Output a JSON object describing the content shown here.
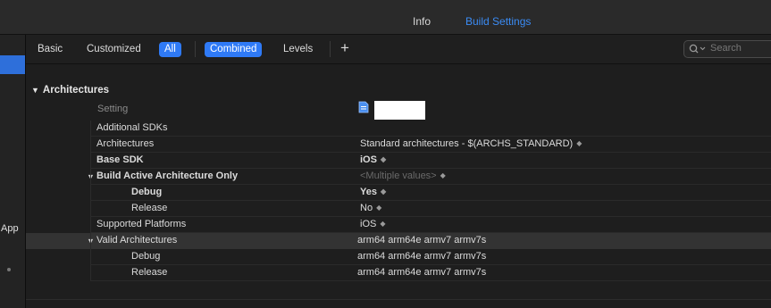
{
  "top_tabs": [
    {
      "label": "Info",
      "active": false
    },
    {
      "label": "Build Settings",
      "active": true
    }
  ],
  "sidebar": {
    "app_label": "App"
  },
  "filters": {
    "basic": "Basic",
    "customized": "Customized",
    "all": "All",
    "combined": "Combined",
    "levels": "Levels",
    "add": "+"
  },
  "search": {
    "placeholder": "Search"
  },
  "section": {
    "title": "Architectures"
  },
  "header_row": {
    "name": "Setting"
  },
  "rows": [
    {
      "name": "Additional SDKs",
      "value": ""
    },
    {
      "name": "Architectures",
      "value": "Standard architectures  -  $(ARCHS_STANDARD)"
    },
    {
      "name": "Base SDK",
      "value": "iOS"
    },
    {
      "name": "Build Active Architecture Only",
      "value": "<Multiple values>"
    },
    {
      "name": "Debug",
      "value": "Yes"
    },
    {
      "name": "Release",
      "value": "No"
    },
    {
      "name": "Supported Platforms",
      "value": "iOS"
    },
    {
      "name": "Valid Architectures",
      "value": "arm64 arm64e armv7 armv7s"
    },
    {
      "name": "Debug",
      "value": "arm64 arm64e armv7 armv7s"
    },
    {
      "name": "Release",
      "value": "arm64 arm64e armv7 armv7s"
    }
  ],
  "colors": {
    "accent": "#2f7af6",
    "tab_active": "#3b8cf5",
    "background": "#1e1e1e"
  }
}
